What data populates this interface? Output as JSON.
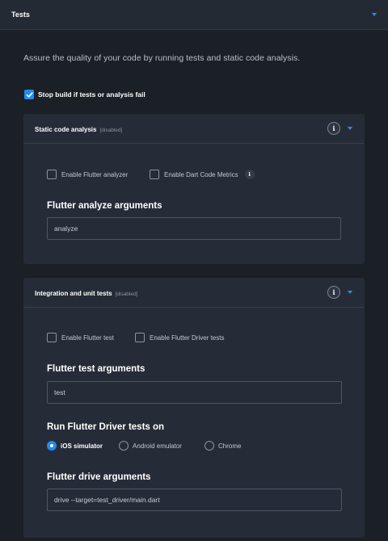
{
  "header": {
    "title": "Tests"
  },
  "intro": "Assure the quality of your code by running tests and static code analysis.",
  "stop_build": {
    "label": "Stop build if tests or analysis fail",
    "checked": true
  },
  "static_panel": {
    "title": "Static code analysis",
    "tag": "[disabled]",
    "options": [
      {
        "label": "Enable Flutter analyzer",
        "checked": false
      },
      {
        "label": "Enable Dart Code Metrics",
        "checked": false
      }
    ],
    "args_heading": "Flutter analyze arguments",
    "args_value": "analyze"
  },
  "tests_panel": {
    "title": "Integration and unit tests",
    "tag": "[disabled]",
    "options": [
      {
        "label": "Enable Flutter test",
        "checked": false
      },
      {
        "label": "Enable Flutter Driver tests",
        "checked": false
      }
    ],
    "test_args_heading": "Flutter test arguments",
    "test_args_value": "test",
    "driver_heading": "Run Flutter Driver tests on",
    "driver_options": [
      {
        "label": "iOS simulator",
        "selected": true
      },
      {
        "label": "Android emulator",
        "selected": false
      },
      {
        "label": "Chrome",
        "selected": false
      }
    ],
    "drive_args_heading": "Flutter drive arguments",
    "drive_args_value": "drive --target=test_driver/main.dart"
  },
  "info_glyph": "i",
  "colors": {
    "accent": "#1f8cf0",
    "background": "#1b1f26",
    "panel": "#262c37"
  }
}
